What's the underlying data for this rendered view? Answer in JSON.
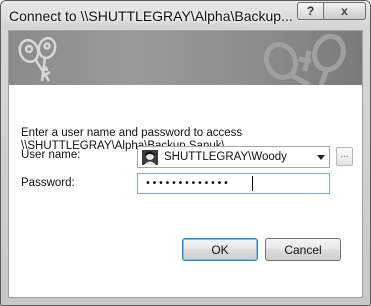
{
  "window": {
    "title": "Connect to \\\\SHUTTLEGRAY\\Alpha\\Backup...",
    "help_label": "?",
    "close_label": "x"
  },
  "dialog": {
    "prompt_line1": "Enter a user name and password to access",
    "prompt_line2": "\\\\SHUTTLEGRAY\\Alpha\\Backup Sanuk\\.",
    "username_label": "User name:",
    "username_value": "SHUTTLEGRAY\\Woody",
    "browse_label": "...",
    "password_label": "Password:",
    "password_value": "•••••••••••••",
    "ok_label": "OK",
    "cancel_label": "Cancel"
  },
  "icons": {
    "banner": "keys-icon",
    "user": "user-icon",
    "dropdown": "chevron-down-icon"
  },
  "colors": {
    "banner": "#8e8e8e",
    "focus_border": "#7aa7d6",
    "default_button_border": "#3c7fb1"
  }
}
